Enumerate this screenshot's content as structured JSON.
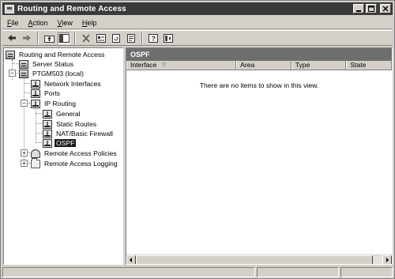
{
  "window": {
    "title": "Routing and Remote Access"
  },
  "menu": [
    {
      "label_u": "F",
      "label_rest": "ile"
    },
    {
      "label_u": "A",
      "label_rest": "ction"
    },
    {
      "label_u": "V",
      "label_rest": "iew"
    },
    {
      "label_u": "H",
      "label_rest": "elp"
    }
  ],
  "toolbar": {
    "icons": [
      "back-arrow-icon",
      "forward-arrow-icon",
      "up-folder-icon",
      "show-hide-tree-icon",
      "delete-icon",
      "properties-icon",
      "refresh-icon",
      "export-list-icon",
      "help-icon",
      "console-icon"
    ]
  },
  "tree": {
    "root": "Routing and Remote Access",
    "server_status": "Server Status",
    "server": "PTGM503 (local)",
    "network_interfaces": "Network Interfaces",
    "ports": "Ports",
    "ip_routing": "IP Routing",
    "general": "General",
    "static_routes": "Static Routes",
    "nat": "NAT/Basic Firewall",
    "ospf": "OSPF",
    "remote_access_policies": "Remote Access Policies",
    "remote_access_logging": "Remote Access Logging"
  },
  "right_panel": {
    "header": "OSPF",
    "columns": [
      "Interface",
      "Area",
      "Type",
      "State"
    ],
    "empty_message": "There are no items to show in this view."
  }
}
